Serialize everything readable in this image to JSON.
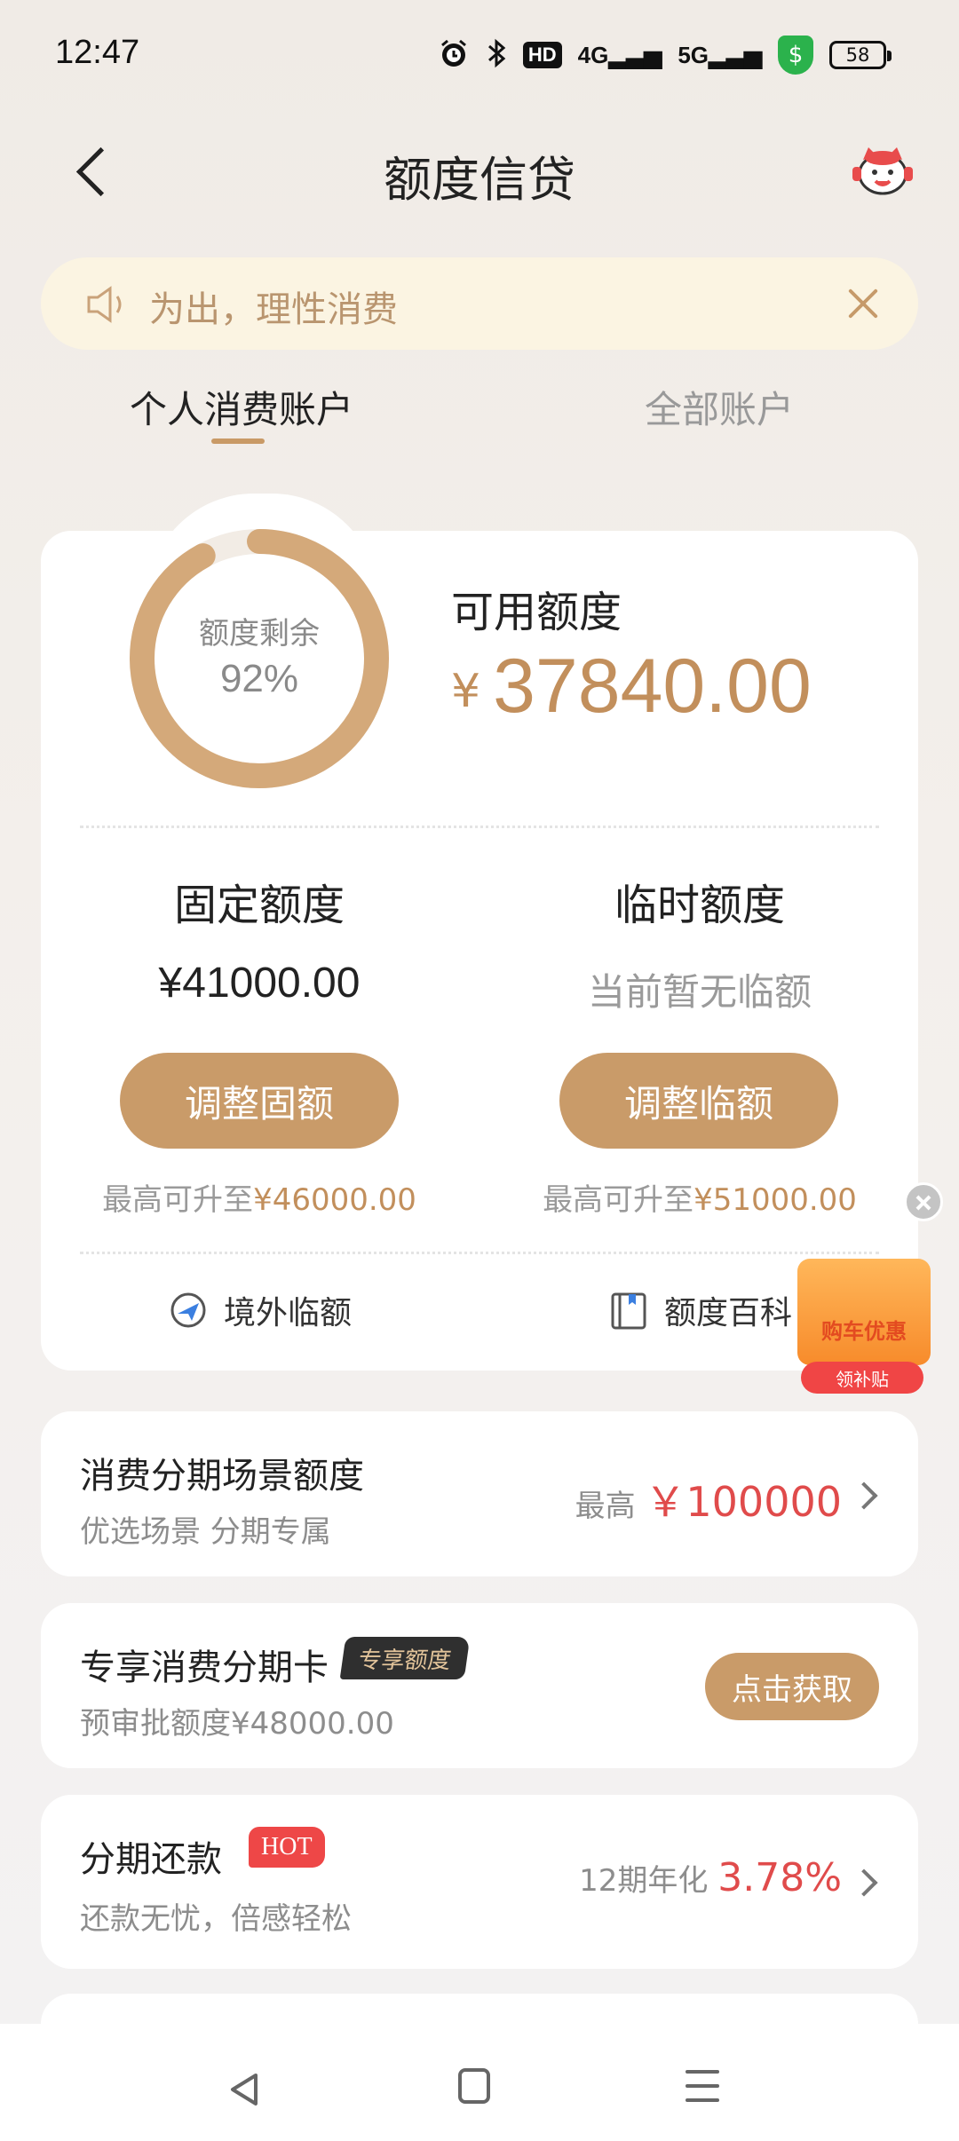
{
  "status_bar": {
    "time": "12:47",
    "battery": "58",
    "icons": [
      "alarm-icon",
      "bluetooth-icon",
      "hd-icon",
      "4g-signal-icon",
      "5g-signal-icon",
      "shield-icon",
      "battery-icon"
    ],
    "hd_label": "HD",
    "net1": "4G",
    "net2": "5G",
    "shield_glyph": "$"
  },
  "header": {
    "title": "额度信贷",
    "back_icon": "chevron-left-icon",
    "mascot_icon": "mascot-icon"
  },
  "notice": {
    "text": "为出，理性消费",
    "icon": "speaker-icon",
    "close_icon": "close-icon"
  },
  "tabs": [
    {
      "label": "个人消费账户",
      "active": true
    },
    {
      "label": "全部账户",
      "active": false
    }
  ],
  "credit": {
    "ring_label": "额度剩余",
    "ring_percent": "92%",
    "remaining_fraction": 0.92,
    "available_label": "可用额度",
    "currency": "¥",
    "available_value": "37840.00",
    "fixed": {
      "title": "固定额度",
      "value": "¥41000.00",
      "button": "调整固额",
      "max_prefix": "最高可升至",
      "max_value": "¥46000.00"
    },
    "temp": {
      "title": "临时额度",
      "value": "当前暂无临额",
      "button": "调整临额",
      "max_prefix": "最高可升至",
      "max_value": "¥51000.00"
    },
    "links": [
      {
        "label": "境外临额",
        "icon": "plane-icon"
      },
      {
        "label": "额度百科",
        "icon": "book-icon"
      }
    ]
  },
  "promo": {
    "title": "购车优惠",
    "pill": "领补贴"
  },
  "cards": {
    "installment_scene": {
      "title": "消费分期场景额度",
      "sub": "优选场景 分期专属",
      "meta_prefix": "最高",
      "meta_value": "￥100000"
    },
    "exclusive_card": {
      "title": "专享消费分期卡",
      "badge": "专享额度",
      "sub": "预审批额度¥48000.00",
      "button": "点击获取"
    },
    "installment_repay": {
      "title": "分期还款",
      "badge": "HOT",
      "sub": "还款无忧，倍感轻松",
      "meta_prefix": "12期年化",
      "meta_value": "3.78%"
    }
  },
  "colors": {
    "accent": "#c99b69",
    "accent_text": "#c28f5c",
    "red": "#e04b4b",
    "notice_bg": "#fbf4e2"
  }
}
